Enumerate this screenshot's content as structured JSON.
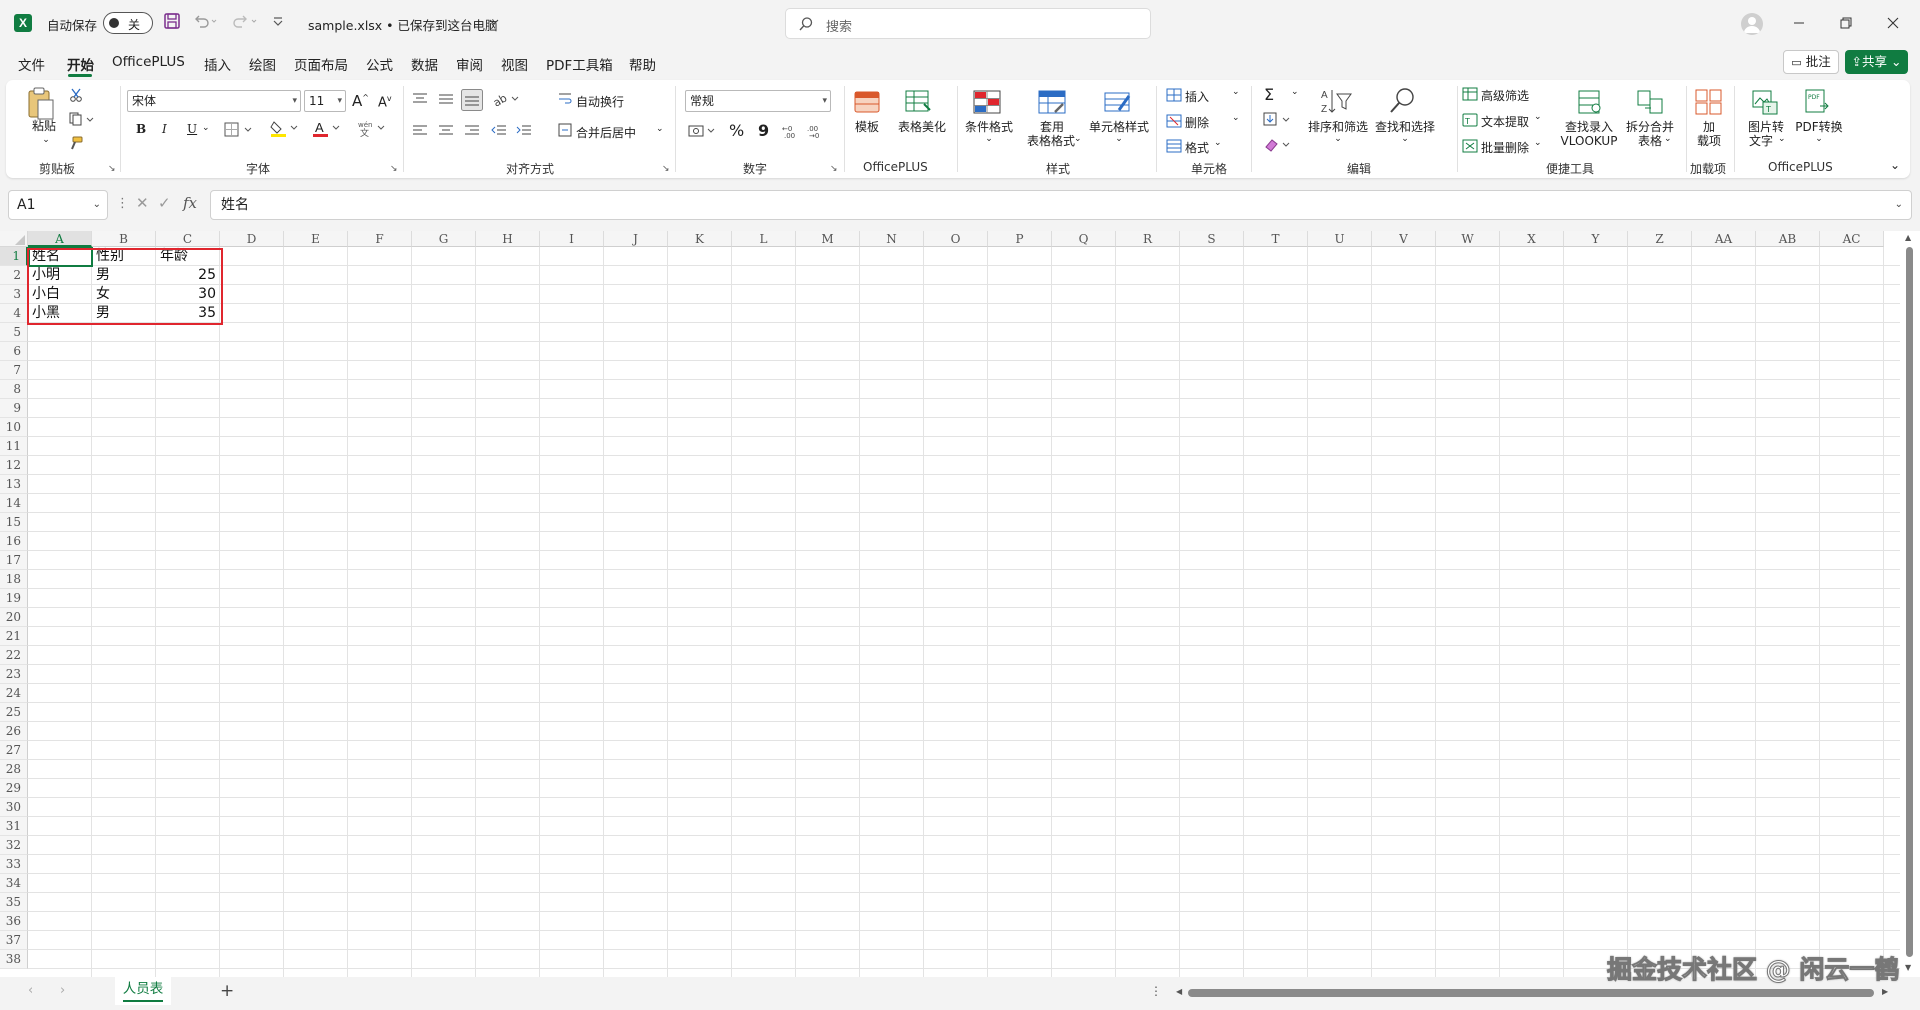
{
  "titlebar": {
    "autosave_label": "自动保存",
    "autosave_state": "关",
    "doc_title": "sample.xlsx • 已保存到这台电脑",
    "search_placeholder": "搜索",
    "min_icon": "minimize-icon",
    "restore_icon": "restore-icon",
    "close_icon": "close-icon"
  },
  "menu": {
    "tabs": [
      "文件",
      "开始",
      "OfficePLUS",
      "插入",
      "绘图",
      "页面布局",
      "公式",
      "数据",
      "审阅",
      "视图",
      "PDF工具箱",
      "帮助"
    ],
    "active_tab": "开始",
    "comment_label": "批注",
    "share_label": "共享"
  },
  "ribbon": {
    "clipboard": {
      "paste": "粘贴",
      "group": "剪贴板"
    },
    "font": {
      "family": "宋体",
      "size": "11",
      "group": "字体",
      "grow": "A",
      "shrink": "A",
      "bold": "B",
      "italic": "I",
      "underline": "U",
      "font_color": "A",
      "pinyin": "wén"
    },
    "alignment": {
      "wrap": "自动换行",
      "merge": "合并后居中",
      "group": "对齐方式"
    },
    "number": {
      "format": "常规",
      "group": "数字",
      "percent": "%",
      "comma": "9"
    },
    "officeplus": {
      "template": "模板",
      "beautify": "表格美化",
      "group": "OfficePLUS"
    },
    "styles": {
      "conditional": "条件格式",
      "table_line1": "套用",
      "table_line2": "表格格式",
      "cell_styles": "单元格样式",
      "group": "样式"
    },
    "cells": {
      "insert": "插入",
      "delete": "删除",
      "format": "格式",
      "group": "单元格"
    },
    "editing": {
      "sigma": "Σ",
      "sort": "排序和筛选",
      "find": "查找和选择",
      "group": "编辑"
    },
    "tools": {
      "advanced_filter": "高级筛选",
      "text_extract": "文本提取",
      "batch_delete": "批量删除",
      "lookup_line1": "查找录入",
      "lookup_line2": "VLOOKUP",
      "split_line1": "拆分合并",
      "split_line2": "表格",
      "group": "便捷工具"
    },
    "addins": {
      "line1": "加",
      "line2": "载项",
      "group": "加载项"
    },
    "officeplus2": {
      "img_line1": "图片转",
      "img_line2": "文字",
      "pdf": "PDF转换",
      "group": "OfficePLUS"
    }
  },
  "formula_bar": {
    "name_box": "A1",
    "fx": "fx",
    "content": "姓名"
  },
  "columns": [
    "A",
    "B",
    "C",
    "D",
    "E",
    "F",
    "G",
    "H",
    "I",
    "J",
    "K",
    "L",
    "M",
    "N",
    "O",
    "P",
    "Q",
    "R",
    "S",
    "T",
    "U",
    "V",
    "W",
    "X",
    "Y",
    "Z",
    "AA",
    "AB",
    "AC"
  ],
  "rows": [
    "1",
    "2",
    "3",
    "4",
    "5",
    "6",
    "7",
    "8",
    "9",
    "10",
    "11",
    "12",
    "13",
    "14",
    "15",
    "16",
    "17",
    "18",
    "19",
    "20",
    "21",
    "22",
    "23",
    "24",
    "25",
    "26",
    "27",
    "28",
    "29",
    "30",
    "31",
    "32",
    "33",
    "34",
    "35",
    "36",
    "37",
    "38"
  ],
  "table": [
    {
      "A": "姓名",
      "B": "性别",
      "C": "年龄"
    },
    {
      "A": "小明",
      "B": "男",
      "C": "25"
    },
    {
      "A": "小白",
      "B": "女",
      "C": "30"
    },
    {
      "A": "小黑",
      "B": "男",
      "C": "35"
    }
  ],
  "sheets": {
    "tabs": [
      "人员表"
    ],
    "add": "+"
  },
  "watermark": "掘金技术社区 @ 闲云一鹤",
  "colors": {
    "accent": "#107c41",
    "highlight_box": "#e0262e"
  }
}
